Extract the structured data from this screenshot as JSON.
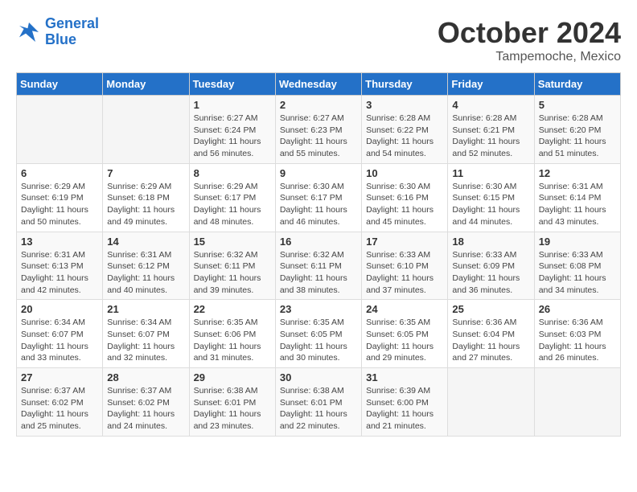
{
  "header": {
    "logo": {
      "line1": "General",
      "line2": "Blue"
    },
    "month": "October 2024",
    "location": "Tampemoche, Mexico"
  },
  "weekdays": [
    "Sunday",
    "Monday",
    "Tuesday",
    "Wednesday",
    "Thursday",
    "Friday",
    "Saturday"
  ],
  "weeks": [
    [
      {
        "day": "",
        "info": ""
      },
      {
        "day": "",
        "info": ""
      },
      {
        "day": "1",
        "info": "Sunrise: 6:27 AM\nSunset: 6:24 PM\nDaylight: 11 hours and 56 minutes."
      },
      {
        "day": "2",
        "info": "Sunrise: 6:27 AM\nSunset: 6:23 PM\nDaylight: 11 hours and 55 minutes."
      },
      {
        "day": "3",
        "info": "Sunrise: 6:28 AM\nSunset: 6:22 PM\nDaylight: 11 hours and 54 minutes."
      },
      {
        "day": "4",
        "info": "Sunrise: 6:28 AM\nSunset: 6:21 PM\nDaylight: 11 hours and 52 minutes."
      },
      {
        "day": "5",
        "info": "Sunrise: 6:28 AM\nSunset: 6:20 PM\nDaylight: 11 hours and 51 minutes."
      }
    ],
    [
      {
        "day": "6",
        "info": "Sunrise: 6:29 AM\nSunset: 6:19 PM\nDaylight: 11 hours and 50 minutes."
      },
      {
        "day": "7",
        "info": "Sunrise: 6:29 AM\nSunset: 6:18 PM\nDaylight: 11 hours and 49 minutes."
      },
      {
        "day": "8",
        "info": "Sunrise: 6:29 AM\nSunset: 6:17 PM\nDaylight: 11 hours and 48 minutes."
      },
      {
        "day": "9",
        "info": "Sunrise: 6:30 AM\nSunset: 6:17 PM\nDaylight: 11 hours and 46 minutes."
      },
      {
        "day": "10",
        "info": "Sunrise: 6:30 AM\nSunset: 6:16 PM\nDaylight: 11 hours and 45 minutes."
      },
      {
        "day": "11",
        "info": "Sunrise: 6:30 AM\nSunset: 6:15 PM\nDaylight: 11 hours and 44 minutes."
      },
      {
        "day": "12",
        "info": "Sunrise: 6:31 AM\nSunset: 6:14 PM\nDaylight: 11 hours and 43 minutes."
      }
    ],
    [
      {
        "day": "13",
        "info": "Sunrise: 6:31 AM\nSunset: 6:13 PM\nDaylight: 11 hours and 42 minutes."
      },
      {
        "day": "14",
        "info": "Sunrise: 6:31 AM\nSunset: 6:12 PM\nDaylight: 11 hours and 40 minutes."
      },
      {
        "day": "15",
        "info": "Sunrise: 6:32 AM\nSunset: 6:11 PM\nDaylight: 11 hours and 39 minutes."
      },
      {
        "day": "16",
        "info": "Sunrise: 6:32 AM\nSunset: 6:11 PM\nDaylight: 11 hours and 38 minutes."
      },
      {
        "day": "17",
        "info": "Sunrise: 6:33 AM\nSunset: 6:10 PM\nDaylight: 11 hours and 37 minutes."
      },
      {
        "day": "18",
        "info": "Sunrise: 6:33 AM\nSunset: 6:09 PM\nDaylight: 11 hours and 36 minutes."
      },
      {
        "day": "19",
        "info": "Sunrise: 6:33 AM\nSunset: 6:08 PM\nDaylight: 11 hours and 34 minutes."
      }
    ],
    [
      {
        "day": "20",
        "info": "Sunrise: 6:34 AM\nSunset: 6:07 PM\nDaylight: 11 hours and 33 minutes."
      },
      {
        "day": "21",
        "info": "Sunrise: 6:34 AM\nSunset: 6:07 PM\nDaylight: 11 hours and 32 minutes."
      },
      {
        "day": "22",
        "info": "Sunrise: 6:35 AM\nSunset: 6:06 PM\nDaylight: 11 hours and 31 minutes."
      },
      {
        "day": "23",
        "info": "Sunrise: 6:35 AM\nSunset: 6:05 PM\nDaylight: 11 hours and 30 minutes."
      },
      {
        "day": "24",
        "info": "Sunrise: 6:35 AM\nSunset: 6:05 PM\nDaylight: 11 hours and 29 minutes."
      },
      {
        "day": "25",
        "info": "Sunrise: 6:36 AM\nSunset: 6:04 PM\nDaylight: 11 hours and 27 minutes."
      },
      {
        "day": "26",
        "info": "Sunrise: 6:36 AM\nSunset: 6:03 PM\nDaylight: 11 hours and 26 minutes."
      }
    ],
    [
      {
        "day": "27",
        "info": "Sunrise: 6:37 AM\nSunset: 6:02 PM\nDaylight: 11 hours and 25 minutes."
      },
      {
        "day": "28",
        "info": "Sunrise: 6:37 AM\nSunset: 6:02 PM\nDaylight: 11 hours and 24 minutes."
      },
      {
        "day": "29",
        "info": "Sunrise: 6:38 AM\nSunset: 6:01 PM\nDaylight: 11 hours and 23 minutes."
      },
      {
        "day": "30",
        "info": "Sunrise: 6:38 AM\nSunset: 6:01 PM\nDaylight: 11 hours and 22 minutes."
      },
      {
        "day": "31",
        "info": "Sunrise: 6:39 AM\nSunset: 6:00 PM\nDaylight: 11 hours and 21 minutes."
      },
      {
        "day": "",
        "info": ""
      },
      {
        "day": "",
        "info": ""
      }
    ]
  ]
}
